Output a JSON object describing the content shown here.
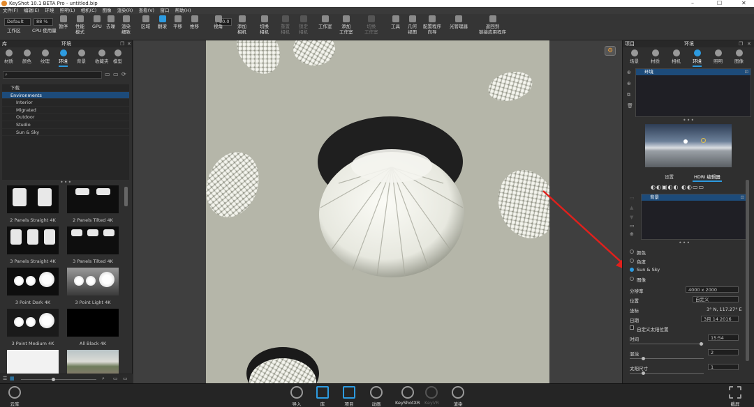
{
  "window": {
    "title": "KeyShot 10.1 BETA Pro  - untitled.bip",
    "controls": [
      "–",
      "☐",
      "✕"
    ]
  },
  "menu": [
    "文件(F)",
    "编辑(E)",
    "环境",
    "照明(L)",
    "相机(C)",
    "图像",
    "渲染(R)",
    "查看(V)",
    "窗口",
    "帮助(H)"
  ],
  "toolbar": {
    "workspace_select": "Default",
    "cpu_select": "88 %",
    "fov_value": "50.0",
    "items": [
      {
        "label": "工作区",
        "state": "normal"
      },
      {
        "label": "CPU 使用量",
        "state": "normal"
      },
      {
        "label": "暂停",
        "state": "normal"
      },
      {
        "label": "性能\n模式",
        "state": "normal"
      },
      {
        "label": "GPU",
        "state": "normal"
      },
      {
        "label": "去噪",
        "state": "normal"
      },
      {
        "label": "渲染\n细致",
        "state": "normal"
      },
      {
        "label": "区域",
        "state": "normal"
      },
      {
        "label": "翻滚",
        "state": "active"
      },
      {
        "label": "平移",
        "state": "normal"
      },
      {
        "label": "推移",
        "state": "normal"
      },
      {
        "label": "视角",
        "state": "normal"
      },
      {
        "label": "添加\n相机",
        "state": "normal"
      },
      {
        "label": "切换\n相机",
        "state": "normal"
      },
      {
        "label": "重置\n相机",
        "state": "dim"
      },
      {
        "label": "锁定\n相机",
        "state": "dim"
      },
      {
        "label": "工作室",
        "state": "normal"
      },
      {
        "label": "添加\n工作室",
        "state": "normal"
      },
      {
        "label": "切换\n工作室",
        "state": "dim"
      },
      {
        "label": "工具",
        "state": "normal"
      },
      {
        "label": "几何\n视图",
        "state": "normal"
      },
      {
        "label": "配置程序\n向导",
        "state": "normal"
      },
      {
        "label": "光管理器",
        "state": "normal"
      },
      {
        "label": "返回到\n链接应用程序",
        "state": "normal"
      }
    ]
  },
  "library": {
    "panel_title": "库",
    "section_title": "环境",
    "tabs": [
      "材质",
      "颜色",
      "纹理",
      "环境",
      "背景",
      "收藏夹",
      "模型"
    ],
    "active_tab": "环境",
    "tree": [
      {
        "label": "下载",
        "level": 0,
        "selected": false
      },
      {
        "label": "Environments",
        "level": 0,
        "selected": true
      },
      {
        "label": "Interior",
        "level": 1,
        "selected": false
      },
      {
        "label": "Migrated",
        "level": 1,
        "selected": false
      },
      {
        "label": "Outdoor",
        "level": 1,
        "selected": false
      },
      {
        "label": "Studio",
        "level": 1,
        "selected": false
      },
      {
        "label": "Sun & Sky",
        "level": 1,
        "selected": false
      }
    ],
    "thumbnails": [
      "2 Panels Straight 4K",
      "2 Panels Tilted 4K",
      "3 Panels Straight 4K",
      "3 Panels Tilted 4K",
      "3 Point Dark 4K",
      "3 Point Light 4K",
      "3 Point Medium 4K",
      "All Black 4K"
    ]
  },
  "project": {
    "panel_title": "项目",
    "section_title": "环境",
    "tabs": [
      "场景",
      "材质",
      "相机",
      "环境",
      "照明",
      "图像"
    ],
    "active_tab": "环境",
    "env_list": [
      "环境"
    ],
    "subtabs": [
      "设置",
      "HDRI 编辑器"
    ],
    "active_subtab": "HDRI 编辑器",
    "bg_list": [
      "背景"
    ],
    "background_options": [
      {
        "label": "颜色",
        "selected": false
      },
      {
        "label": "色度",
        "selected": false
      },
      {
        "label": "Sun & Sky",
        "selected": true
      },
      {
        "label": "图像",
        "selected": false
      }
    ],
    "resolution_label": "分辨率",
    "resolution_value": "4000 x 2000",
    "location_label": "位置",
    "location_value": "自定义",
    "coords_label": "坐标",
    "coords_value": "3° N, 117.27° E",
    "date_label": "日期",
    "date_value": "3月 14 2016",
    "custom_sun_label": "自定义太阳位置",
    "time_label": "时间",
    "time_value": "15:54",
    "turbidity_label": "混浊",
    "turbidity_value": "2",
    "sun_size_label": "太阳尺寸",
    "sun_size_value": "1"
  },
  "bottombar": {
    "left_label": "云库",
    "items": [
      {
        "label": "导入",
        "state": "normal"
      },
      {
        "label": "库",
        "state": "active"
      },
      {
        "label": "项目",
        "state": "active"
      },
      {
        "label": "动画",
        "state": "normal"
      },
      {
        "label": "KeyShotXR",
        "state": "normal"
      },
      {
        "label": "KeyVR",
        "state": "dim"
      },
      {
        "label": "渲染",
        "state": "normal"
      }
    ],
    "right_label": "截屏"
  },
  "colors": {
    "accent": "#2d9be0",
    "selection": "#1d4b7a",
    "arrow": "#e0201c",
    "render_bg": "#b5b6a9"
  }
}
